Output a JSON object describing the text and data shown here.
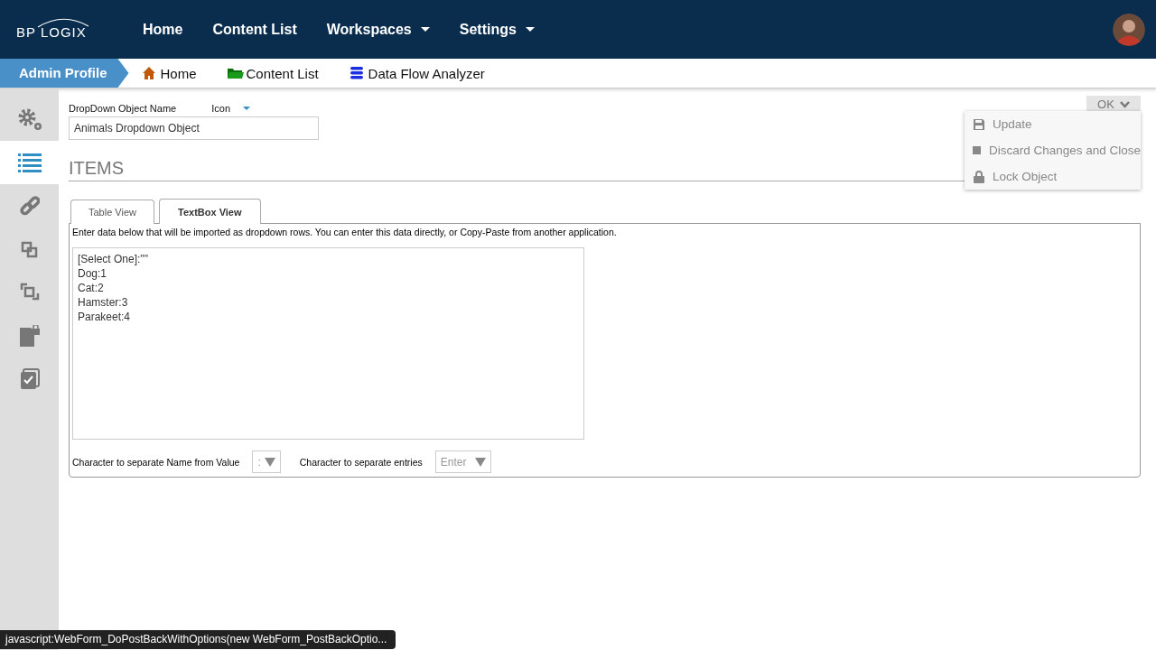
{
  "header": {
    "logo": "BP LOGIX",
    "nav": [
      {
        "label": "Home",
        "dropdown": false
      },
      {
        "label": "Content List",
        "dropdown": false
      },
      {
        "label": "Workspaces",
        "dropdown": true
      },
      {
        "label": "Settings",
        "dropdown": true
      }
    ]
  },
  "breadcrumb": {
    "current": "Admin Profile",
    "links": [
      {
        "label": "Home",
        "kind": "home"
      },
      {
        "label": "Content List",
        "kind": "folder"
      },
      {
        "label": "Data Flow Analyzer",
        "kind": "database"
      }
    ]
  },
  "sidebar": {
    "items": [
      {
        "kind": "gears",
        "selected": false
      },
      {
        "kind": "list",
        "selected": true
      },
      {
        "kind": "link",
        "selected": false
      },
      {
        "kind": "copy",
        "selected": false
      },
      {
        "kind": "duplicate",
        "selected": false
      },
      {
        "kind": "file-lock",
        "selected": false
      },
      {
        "kind": "checklist",
        "selected": false
      }
    ]
  },
  "form": {
    "name_label": "DropDown Object Name",
    "icon_label": "Icon",
    "name_value": "Animals Dropdown Object"
  },
  "section_title": "ITEMS",
  "tabs": [
    {
      "label": "Table View",
      "selected": false
    },
    {
      "label": "TextBox View",
      "selected": true
    }
  ],
  "instructions": "Enter data below that will be imported as dropdown rows. You can enter this data directly, or Copy-Paste from another application.",
  "entries": [
    "[Select One]:\"\"",
    "Dog:1",
    "Cat:2",
    "Hamster:3",
    "Parakeet:4"
  ],
  "separators": [
    {
      "label": "Character to separate Name from Value",
      "value": ":"
    },
    {
      "label": "Character to separate entries",
      "value": "Enter"
    }
  ],
  "ok_button": "OK",
  "menu": [
    {
      "label": "Update",
      "kind": "save"
    },
    {
      "label": "Discard Changes and Close",
      "kind": "square"
    },
    {
      "label": "Lock Object",
      "kind": "lock"
    }
  ],
  "status_tooltip": "javascript:WebForm_DoPostBackWithOptions(new WebForm_PostBackOptio..."
}
